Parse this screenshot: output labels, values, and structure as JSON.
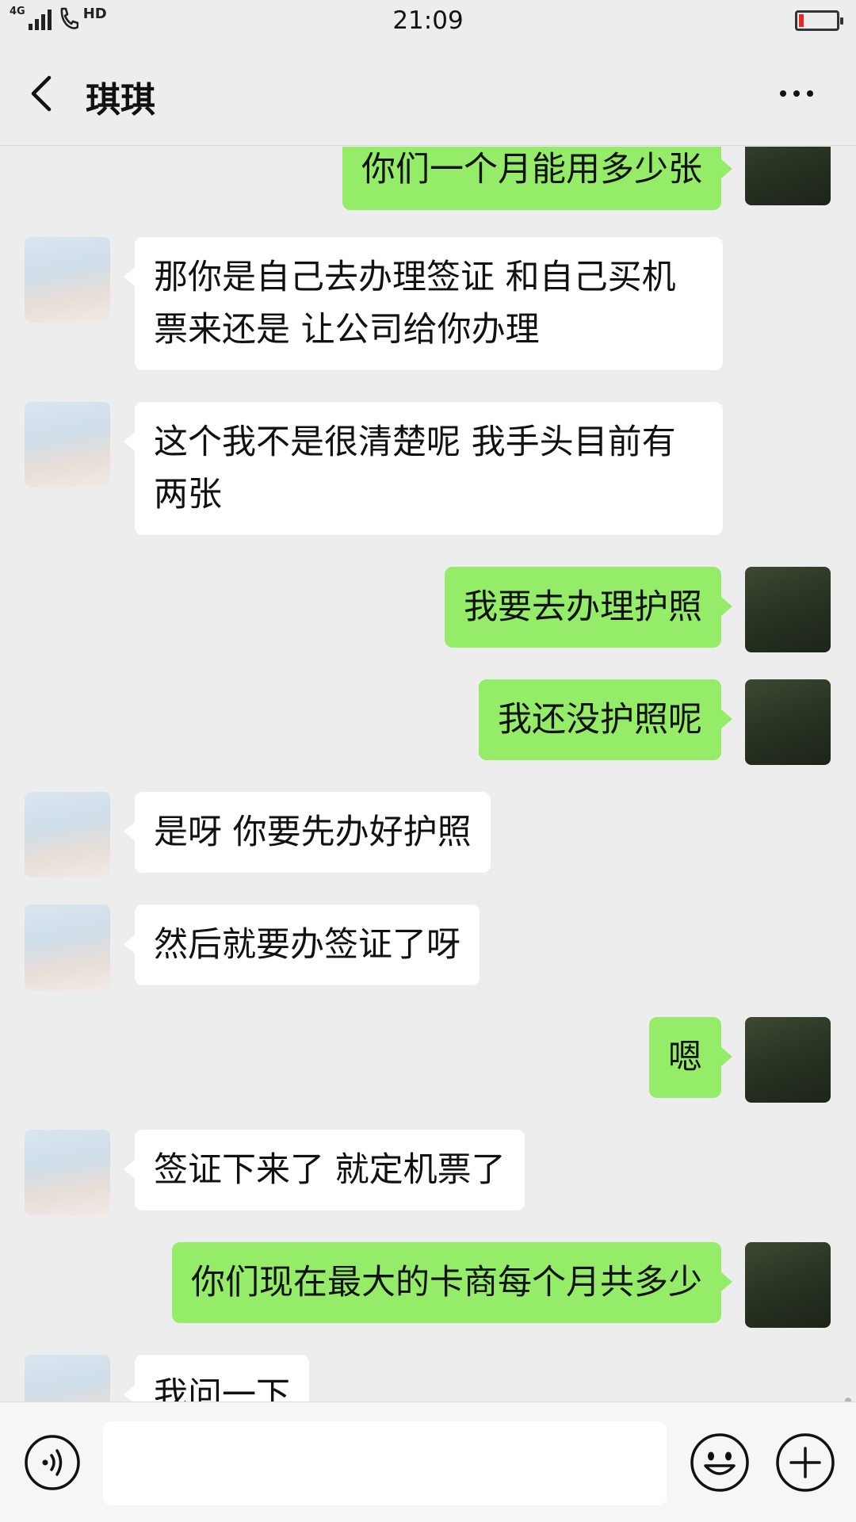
{
  "status_bar": {
    "network": "4G",
    "hd": "HD",
    "time": "21:09",
    "battery_level": 0.12,
    "battery_color": "#e82828"
  },
  "header": {
    "title": "琪琪",
    "back_icon": "chevron-left-icon",
    "more_icon": "more-dots-icon"
  },
  "colors": {
    "background": "#ededed",
    "incoming_bubble": "#ffffff",
    "outgoing_bubble": "#95ec69"
  },
  "messages": [
    {
      "from": "me",
      "text": "你们一个月能用多少张"
    },
    {
      "from": "her",
      "text": "那你是自己去办理签证 和自己买机票来还是 让公司给你办理"
    },
    {
      "from": "her",
      "text": "这个我不是很清楚呢  我手头目前有两张"
    },
    {
      "from": "me",
      "text": "我要去办理护照"
    },
    {
      "from": "me",
      "text": "我还没护照呢"
    },
    {
      "from": "her",
      "text": "是呀 你要先办好护照"
    },
    {
      "from": "her",
      "text": "然后就要办签证了呀"
    },
    {
      "from": "me",
      "text": "嗯"
    },
    {
      "from": "her",
      "text": "签证下来了 就定机票了"
    },
    {
      "from": "me",
      "text": "你们现在最大的卡商每个月共多少"
    },
    {
      "from": "her",
      "text": "我问一下"
    }
  ],
  "input_bar": {
    "voice_icon": "voice-icon",
    "emoji_icon": "emoji-icon",
    "plus_icon": "plus-icon",
    "text_value": ""
  }
}
